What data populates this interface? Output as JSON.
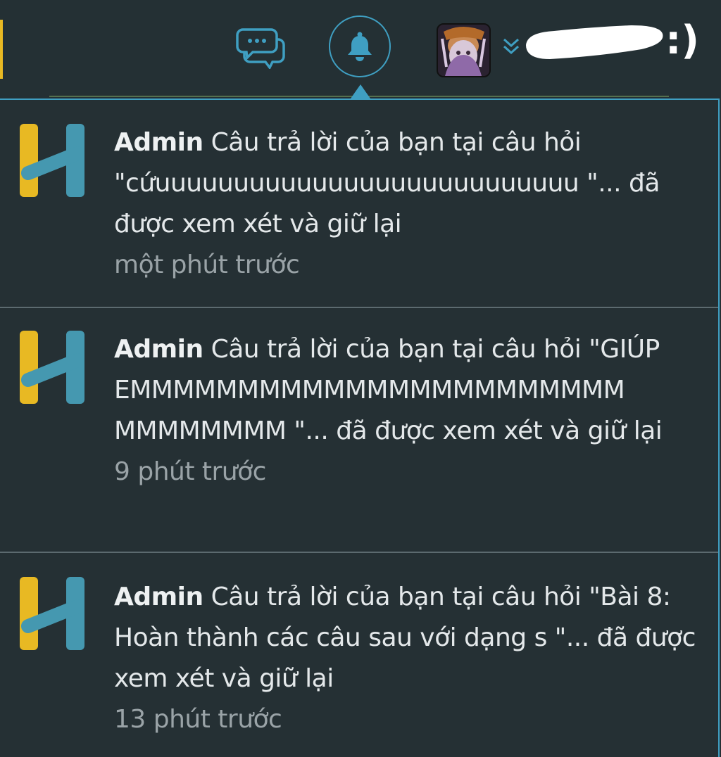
{
  "topbar": {
    "chat_icon": "chat-bubbles-icon",
    "bell_icon": "bell-icon",
    "avatar": "user-avatar",
    "dropdown_icon": "chevron-double-down-icon",
    "smiley": ":)"
  },
  "colors": {
    "background": "#253034",
    "accent": "#3f9fc2",
    "logo_yellow": "#e8b923",
    "logo_blue": "#4598b0",
    "time_text": "#9aa3a7"
  },
  "notifications": [
    {
      "sender": "Admin",
      "message": "Câu trả lời của bạn tại câu hỏi \"cứuuuuuuuuuuuuuuuuuuuuuuuuuuu \"... đã được xem xét và giữ lại",
      "time": "một phút trước",
      "icon": "hoc24-logo-icon"
    },
    {
      "sender": "Admin",
      "message": "Câu trả lời của bạn tại câu hỏi \"GIÚP EMMMMMMMMMMMMMMMMMMMMMMM MMMMMMMM \"... đã được xem xét và giữ lại",
      "time": "9 phút trước",
      "icon": "hoc24-logo-icon"
    },
    {
      "sender": "Admin",
      "message": "Câu trả lời của bạn tại câu hỏi \"Bài 8: Hoàn thành các câu sau với dạng s \"... đã được xem xét và giữ lại",
      "time": "13 phút trước",
      "icon": "hoc24-logo-icon"
    }
  ]
}
